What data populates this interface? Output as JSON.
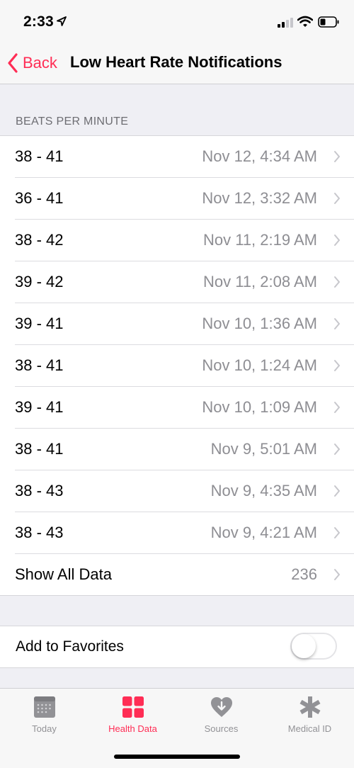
{
  "status_bar": {
    "time": "2:33"
  },
  "nav": {
    "back_label": "Back",
    "title": "Low Heart Rate Notifications"
  },
  "section": {
    "header": "BEATS PER MINUTE"
  },
  "rows": [
    {
      "bpm": "38 - 41",
      "date": "Nov 12, 4:34 AM"
    },
    {
      "bpm": "36 - 41",
      "date": "Nov 12, 3:32 AM"
    },
    {
      "bpm": "38 - 42",
      "date": "Nov 11, 2:19 AM"
    },
    {
      "bpm": "39 - 42",
      "date": "Nov 11, 2:08 AM"
    },
    {
      "bpm": "39 - 41",
      "date": "Nov 10, 1:36 AM"
    },
    {
      "bpm": "38 - 41",
      "date": "Nov 10, 1:24 AM"
    },
    {
      "bpm": "39 - 41",
      "date": "Nov 10, 1:09 AM"
    },
    {
      "bpm": "38 - 41",
      "date": "Nov 9, 5:01 AM"
    },
    {
      "bpm": "38 - 43",
      "date": "Nov 9, 4:35 AM"
    },
    {
      "bpm": "38 - 43",
      "date": "Nov 9, 4:21 AM"
    }
  ],
  "show_all": {
    "label": "Show All Data",
    "count": "236"
  },
  "favorites": {
    "label": "Add to Favorites",
    "enabled": false
  },
  "tabs": [
    {
      "label": "Today",
      "icon": "calendar-icon"
    },
    {
      "label": "Health Data",
      "icon": "grid-icon",
      "active": true
    },
    {
      "label": "Sources",
      "icon": "heart-download-icon"
    },
    {
      "label": "Medical ID",
      "icon": "asterisk-icon"
    }
  ],
  "colors": {
    "accent": "#ff2d55",
    "secondary_text": "#8e8e93",
    "background": "#efeff4"
  }
}
